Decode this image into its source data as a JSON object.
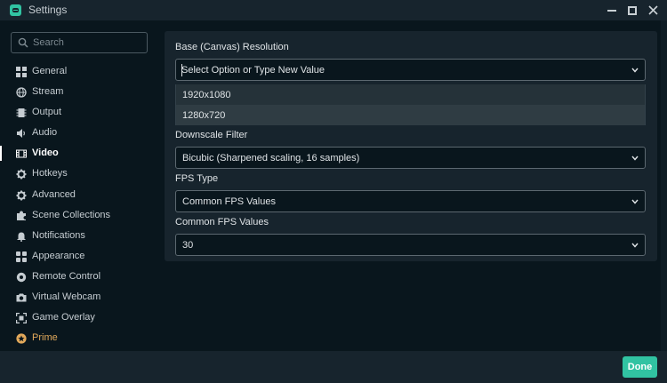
{
  "window": {
    "title": "Settings"
  },
  "search": {
    "placeholder": "Search"
  },
  "sidebar": {
    "items": [
      {
        "label": "General",
        "icon": "grid-icon"
      },
      {
        "label": "Stream",
        "icon": "globe-icon"
      },
      {
        "label": "Output",
        "icon": "chip-icon"
      },
      {
        "label": "Audio",
        "icon": "speaker-icon"
      },
      {
        "label": "Video",
        "icon": "film-icon",
        "active": true
      },
      {
        "label": "Hotkeys",
        "icon": "gear-icon"
      },
      {
        "label": "Advanced",
        "icon": "gear-icon"
      },
      {
        "label": "Scene Collections",
        "icon": "puzzle-icon"
      },
      {
        "label": "Notifications",
        "icon": "bell-icon"
      },
      {
        "label": "Appearance",
        "icon": "palette-icon"
      },
      {
        "label": "Remote Control",
        "icon": "remote-icon"
      },
      {
        "label": "Virtual Webcam",
        "icon": "camera-icon"
      },
      {
        "label": "Game Overlay",
        "icon": "expand-icon"
      },
      {
        "label": "Prime",
        "icon": "star-badge-icon",
        "highlight": "#e2a95b"
      }
    ]
  },
  "video": {
    "base_resolution": {
      "label": "Base (Canvas) Resolution",
      "placeholder": "Select Option or Type New Value",
      "options": [
        "1920x1080",
        "1280x720"
      ],
      "hovered_option": "1280x720"
    },
    "downscale_filter": {
      "label": "Downscale Filter",
      "value": "Bicubic (Sharpened scaling, 16 samples)"
    },
    "fps_type": {
      "label": "FPS Type",
      "value": "Common FPS Values"
    },
    "common_fps": {
      "label": "Common FPS Values",
      "value": "30"
    }
  },
  "footer": {
    "done_label": "Done"
  },
  "colors": {
    "accent": "#31c3a2",
    "background": "#09161d",
    "panel": "#17242d",
    "prime": "#e2a95b"
  }
}
